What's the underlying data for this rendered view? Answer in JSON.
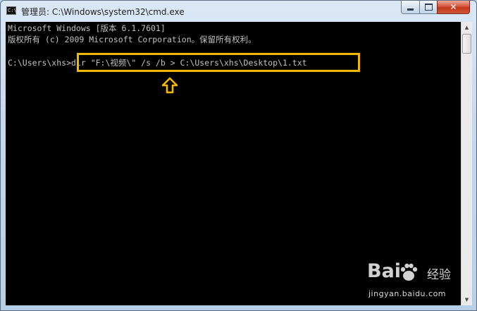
{
  "window": {
    "title": "管理员: C:\\Windows\\system32\\cmd.exe",
    "icon": "cmd-icon"
  },
  "controls": {
    "minimize": "minimize-icon",
    "maximize": "maximize-icon",
    "close": "close-icon",
    "close_glyph": "✕"
  },
  "console": {
    "lines": [
      "Microsoft Windows [版本 6.1.7601]",
      "版权所有 (c) 2009 Microsoft Corporation。保留所有权利。",
      "C:\\Users\\xhs>dir \"F:\\视频\\\" /s /b > C:\\Users\\xhs\\Desktop\\1.txt"
    ]
  },
  "annotation": {
    "highlight_color": "#f4b800",
    "arrow_icon": "up-arrow-icon"
  },
  "watermark": {
    "brand": "Bai",
    "brand_suffix": "经验",
    "url": "jingyan.baidu.com"
  },
  "colors": {
    "console_bg": "#000000",
    "console_text": "#c0c0c0",
    "close_red": "#c1361a"
  }
}
